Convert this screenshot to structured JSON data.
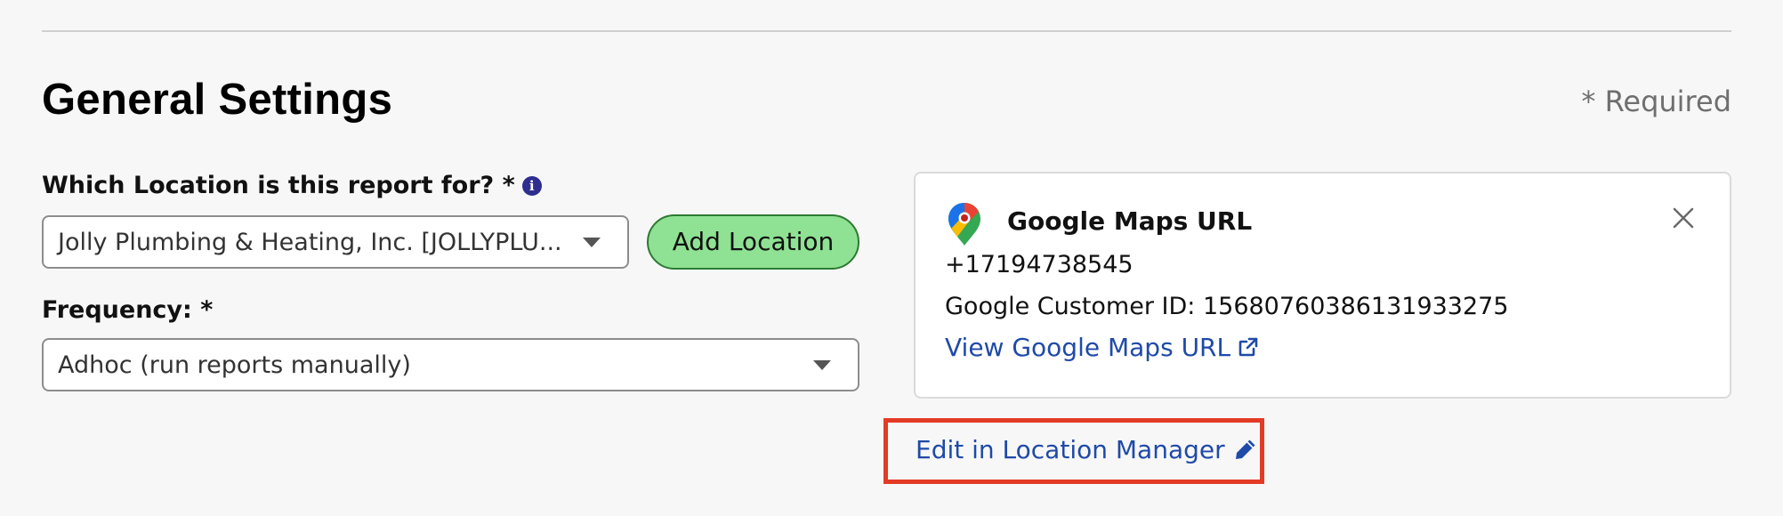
{
  "section": {
    "title": "General Settings",
    "required_note": "* Required"
  },
  "location_field": {
    "label": "Which Location is this report for? *",
    "info_icon": "info-icon",
    "selected_value": "Jolly Plumbing & Heating, Inc. [JOLLYPLU...",
    "caret_icon": "chevron-down-icon"
  },
  "add_location_button": {
    "label": "Add Location"
  },
  "frequency_field": {
    "label": "Frequency: *",
    "selected_value": "Adhoc (run reports manually)",
    "caret_icon": "chevron-down-icon"
  },
  "location_card": {
    "icon": "google-maps-pin-icon",
    "title": "Google Maps URL",
    "phone": "+17194738545",
    "customer_id": "Google Customer ID: 15680760386131933275",
    "maps_link": "View Google Maps URL",
    "maps_link_icon": "external-link-icon",
    "close_icon": "close-icon"
  },
  "edit_link": {
    "label": "Edit in Location Manager",
    "icon": "pencil-icon",
    "highlight_color": "#e33b25"
  },
  "colors": {
    "background": "#f7f7f7",
    "link": "#1f4aa8",
    "button_fill": "#8fe293",
    "button_border": "#2c7a32",
    "info_icon": "#2e2e8f"
  }
}
